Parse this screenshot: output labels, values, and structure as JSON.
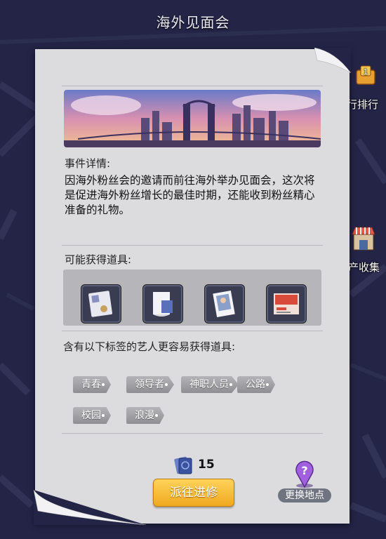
{
  "window": {
    "title": "海外见面会"
  },
  "side_buttons": {
    "ranking_label": "行排行",
    "collect_label": "产收集"
  },
  "event": {
    "details_heading": "事件详情:",
    "description": "因海外粉丝会的邀请而前往海外举办见面会，这次将是促进海外粉丝增长的最佳时期，还能收到粉丝精心准备的礼物。",
    "rewards_heading": "可能获得道具:",
    "reward_items": [
      {
        "icon": "id-card-icon"
      },
      {
        "icon": "paper-roll-icon"
      },
      {
        "icon": "photo-card-icon"
      },
      {
        "icon": "video-poster-icon"
      }
    ],
    "tags_heading": "含有以下标签的艺人更容易获得道具:",
    "tags": [
      "青春",
      "领导者",
      "神职人员",
      "公路",
      "校园",
      "浪漫"
    ]
  },
  "footer": {
    "cost_icon": "passport-icon",
    "cost_value": "15",
    "go_button_label": "派往进修",
    "change_location_label": "更换地点"
  },
  "colors": {
    "background": "#232446",
    "paper": "#dcdcdf",
    "button_gold": "#f0a820",
    "tag_gray": "#9a9aa0"
  }
}
